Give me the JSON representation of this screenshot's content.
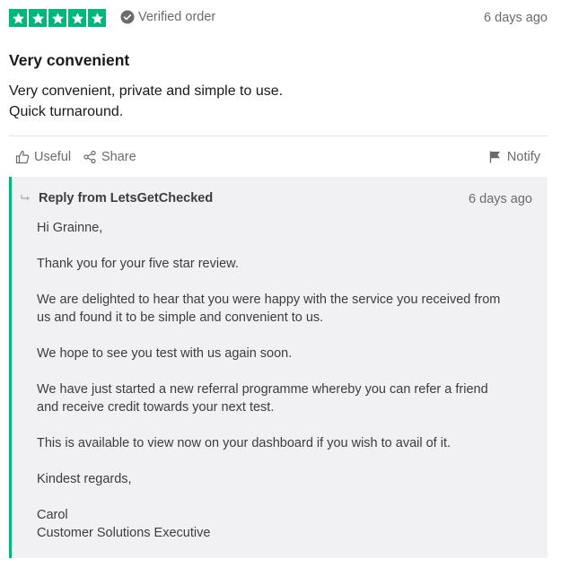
{
  "review": {
    "rating": 5,
    "verified_label": "Verified order",
    "date": "6 days ago",
    "title": "Very convenient",
    "body_lines": [
      "Very convenient, private and simple to use.",
      "Quick turnaround."
    ]
  },
  "actions": {
    "useful_label": "Useful",
    "share_label": "Share",
    "notify_label": "Notify"
  },
  "reply": {
    "header": "Reply from LetsGetChecked",
    "date": "6 days ago",
    "paragraphs": [
      [
        "Hi Grainne,"
      ],
      [
        "Thank you for your five star review."
      ],
      [
        "We are delighted to hear that you were happy with the service you received from",
        "us and found it to be simple and convenient to us."
      ],
      [
        "We hope to see you test with us again soon."
      ],
      [
        "We have just started a new referral programme whereby you can refer a friend",
        "and receive credit towards your next test."
      ],
      [
        "This is available to view now on your dashboard if you wish to avail of it."
      ],
      [
        "Kindest regards,"
      ],
      [
        "Carol",
        "Customer Solutions Executive"
      ]
    ]
  },
  "colors": {
    "star_green": "#00b67a",
    "reply_bg": "#f1f1f4",
    "muted_text": "#6b6b6b"
  },
  "icons": {
    "star": "star-icon",
    "verified": "check-circle-icon",
    "useful": "thumbs-up-icon",
    "share": "share-icon",
    "notify": "flag-icon",
    "reply": "reply-arrow-icon"
  }
}
